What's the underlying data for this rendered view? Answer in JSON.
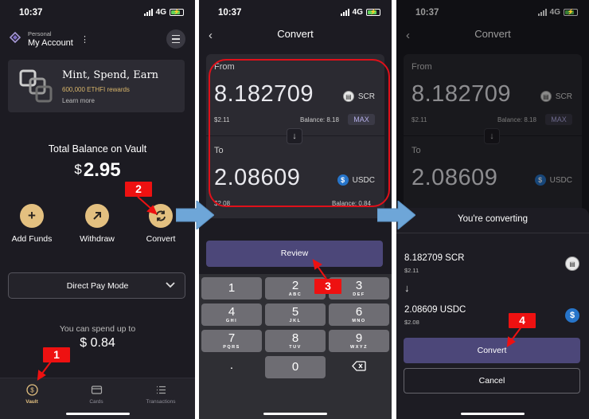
{
  "status": {
    "time": "10:37",
    "network": "4G"
  },
  "screen_vault": {
    "account_label": "Personal",
    "account_name": "My Account",
    "promo_title": "Mint, Spend, Earn",
    "promo_subtitle": "600,000 ETHFI rewards",
    "promo_link": "Learn more",
    "total_label": "Total Balance on Vault",
    "total_currency": "$",
    "total_value": "2.95",
    "actions": [
      {
        "label": "Add Funds",
        "icon": "plus-icon"
      },
      {
        "label": "Withdraw",
        "icon": "arrow-up-right-icon"
      },
      {
        "label": "Convert",
        "icon": "convert-cycle-icon"
      }
    ],
    "mode": "Direct Pay Mode",
    "spend_label": "You can spend up to",
    "spend_value": "$ 0.84",
    "tabs": [
      {
        "label": "Vault",
        "active": true
      },
      {
        "label": "Cards",
        "active": false
      },
      {
        "label": "Transactions",
        "active": false
      }
    ]
  },
  "screen_convert": {
    "title": "Convert",
    "from_label": "From",
    "from_amount": "8.182709",
    "from_token": "SCR",
    "from_usd": "$2.11",
    "from_balance": "Balance: 8.18",
    "max_label": "MAX",
    "to_label": "To",
    "to_amount": "2.08609",
    "to_token": "USDC",
    "to_usd": "$2.08",
    "to_balance": "Balance: 0.84",
    "review_label": "Review",
    "keypad": [
      {
        "digit": "1",
        "letters": ""
      },
      {
        "digit": "2",
        "letters": "ABC"
      },
      {
        "digit": "3",
        "letters": "DEF"
      },
      {
        "digit": "4",
        "letters": "GHI"
      },
      {
        "digit": "5",
        "letters": "JKL"
      },
      {
        "digit": "6",
        "letters": "MNO"
      },
      {
        "digit": "7",
        "letters": "PQRS"
      },
      {
        "digit": "8",
        "letters": "TUV"
      },
      {
        "digit": "9",
        "letters": "WXYZ"
      },
      {
        "digit": "0",
        "letters": ""
      }
    ],
    "decimal_key": "."
  },
  "screen_confirm": {
    "sheet_title": "You're converting",
    "from_amount": "8.182709 SCR",
    "from_usd": "$2.11",
    "to_amount": "2.08609 USDC",
    "to_usd": "$2.08",
    "convert_label": "Convert",
    "cancel_label": "Cancel"
  },
  "annotations": {
    "steps": [
      "1",
      "2",
      "3",
      "4"
    ],
    "highlight_color": "#e0101a",
    "arrow_color": "#6ea6d8"
  },
  "colors": {
    "background": "#1c1b22",
    "card": "#2b2a31",
    "accent_button": "#4c4779",
    "gold": "#e3c080",
    "usdc": "#2775ca"
  }
}
